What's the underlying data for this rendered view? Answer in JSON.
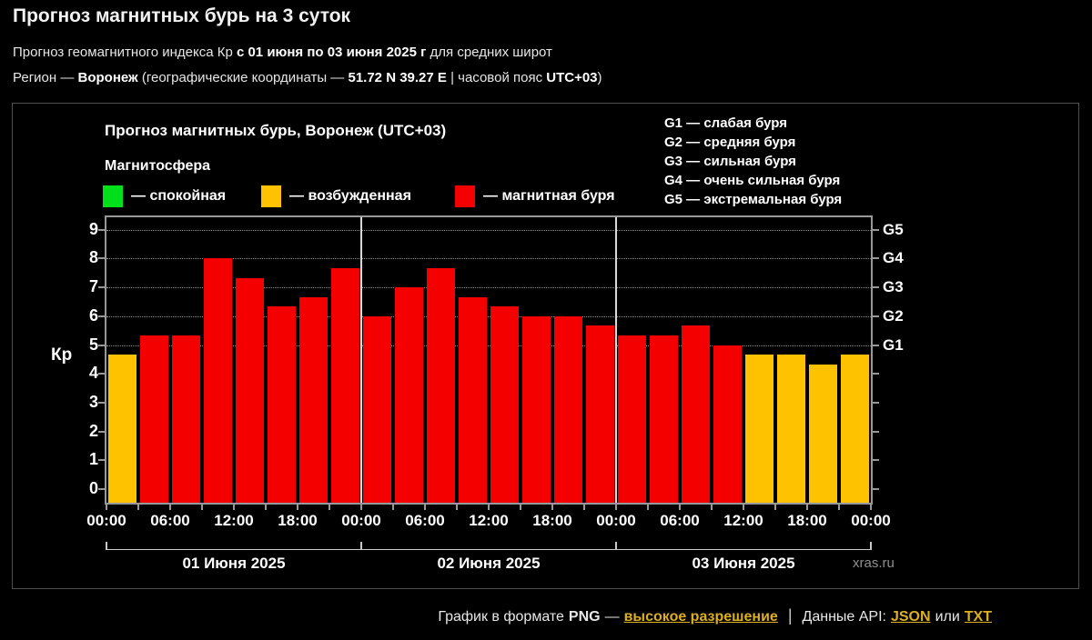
{
  "page": {
    "title": "Прогноз магнитных бурь на 3 суток",
    "subtitle": {
      "prefix": "Прогноз геомагнитного индекса Кр ",
      "bold": "с 01 июня по 03 июня 2025 г",
      "suffix": " для средних широт"
    },
    "region": {
      "prefix": "Регион — ",
      "name": "Воронеж",
      "mid": " (географические координаты — ",
      "coords": "51.72 N 39.27 E",
      "sep": " | часовой пояс ",
      "tz": "UTC+03",
      "close": ")"
    }
  },
  "chart": {
    "title": "Прогноз магнитных бурь, Воронеж (UTC+03)",
    "magnetosphere_label": "Магнитосфера",
    "legend": [
      {
        "name": "quiet",
        "label": "— спокойная",
        "color": "#00e01a"
      },
      {
        "name": "excited",
        "label": "— возбужденная",
        "color": "#ffc200"
      },
      {
        "name": "storm",
        "label": "— магнитная буря",
        "color": "#f50000"
      }
    ],
    "g_legend": [
      "G1 — слабая буря",
      "G2 — средняя буря",
      "G3 — сильная буря",
      "G4 — очень сильная буря",
      "G5 — экстремальная буря"
    ],
    "kp_axis_label": "Кр",
    "watermark": "xras.ru"
  },
  "chart_data": {
    "type": "bar",
    "title": "Прогноз магнитных бурь, Воронеж (UTC+03)",
    "ylabel": "Кр",
    "ylim": [
      0,
      9
    ],
    "bar_interval_hours": 3,
    "y_ticks": [
      0,
      1,
      2,
      3,
      4,
      5,
      6,
      7,
      8,
      9
    ],
    "grid_levels": [
      5,
      6,
      7,
      8,
      9
    ],
    "grid": "horizontal dotted at storm levels",
    "legend_position": "top",
    "right_axis": [
      {
        "kp": 5,
        "label": "G1"
      },
      {
        "kp": 6,
        "label": "G2"
      },
      {
        "kp": 7,
        "label": "G3"
      },
      {
        "kp": 8,
        "label": "G4"
      },
      {
        "kp": 9,
        "label": "G5"
      }
    ],
    "time_labels": [
      "00:00",
      "06:00",
      "12:00",
      "18:00",
      "00:00",
      "06:00",
      "12:00",
      "18:00",
      "00:00",
      "06:00",
      "12:00",
      "18:00",
      "00:00"
    ],
    "days": [
      {
        "date": "01 Июня 2025",
        "values": [
          4.67,
          5.33,
          5.33,
          8.0,
          7.33,
          6.33,
          6.67,
          7.67
        ]
      },
      {
        "date": "02 Июня 2025",
        "values": [
          6.0,
          7.0,
          7.67,
          6.67,
          6.33,
          6.0,
          6.0,
          5.67
        ]
      },
      {
        "date": "03 Июня 2025",
        "values": [
          5.33,
          5.33,
          5.67,
          5.0,
          4.67,
          4.67,
          4.33,
          4.67
        ]
      }
    ],
    "thresholds": {
      "storm_min": 5,
      "excited_min": 4
    },
    "colors": {
      "quiet": "#00e01a",
      "excited": "#ffc200",
      "storm": "#f50000"
    }
  },
  "footer": {
    "prefix": "График в формате",
    "png": "PNG",
    "dash": "—",
    "hires_link": "высокое разрешение",
    "pipe": "|",
    "api_label": "Данные API:",
    "json_link": "JSON",
    "or": "или",
    "txt_link": "TXT"
  }
}
